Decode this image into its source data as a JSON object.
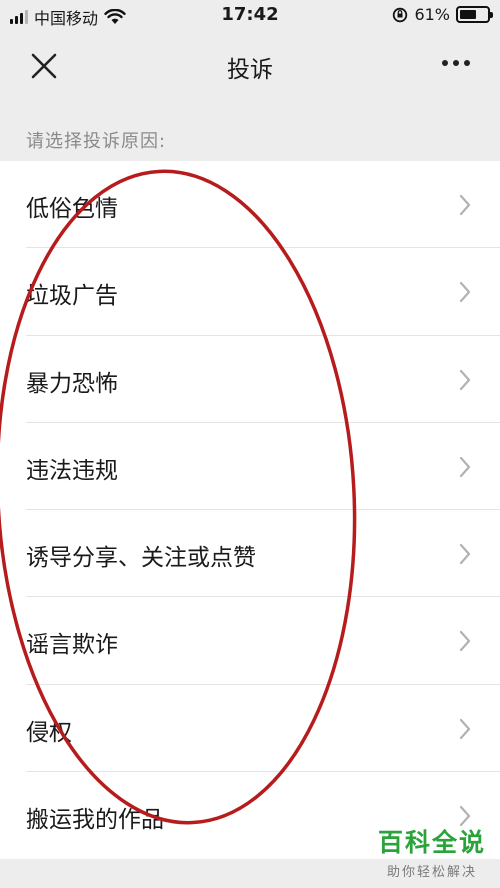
{
  "status_bar": {
    "carrier": "中国移动",
    "time": "17:42",
    "battery_percent": "61%",
    "battery_level": 0.61
  },
  "header": {
    "title": "投诉",
    "close_icon": "close-icon",
    "more_icon": "more-icon"
  },
  "section_label": "请选择投诉原因:",
  "reasons": [
    {
      "label": "低俗色情"
    },
    {
      "label": "垃圾广告"
    },
    {
      "label": "暴力恐怖"
    },
    {
      "label": "违法违规"
    },
    {
      "label": "诱导分享、关注或点赞"
    },
    {
      "label": "谣言欺诈"
    },
    {
      "label": "侵权"
    },
    {
      "label": "搬运我的作品"
    }
  ],
  "annotation": {
    "color": "#b71c1c"
  },
  "watermark": {
    "title": "百科全说",
    "subtitle": "助你轻松解决",
    "color": "#2aa43a"
  }
}
